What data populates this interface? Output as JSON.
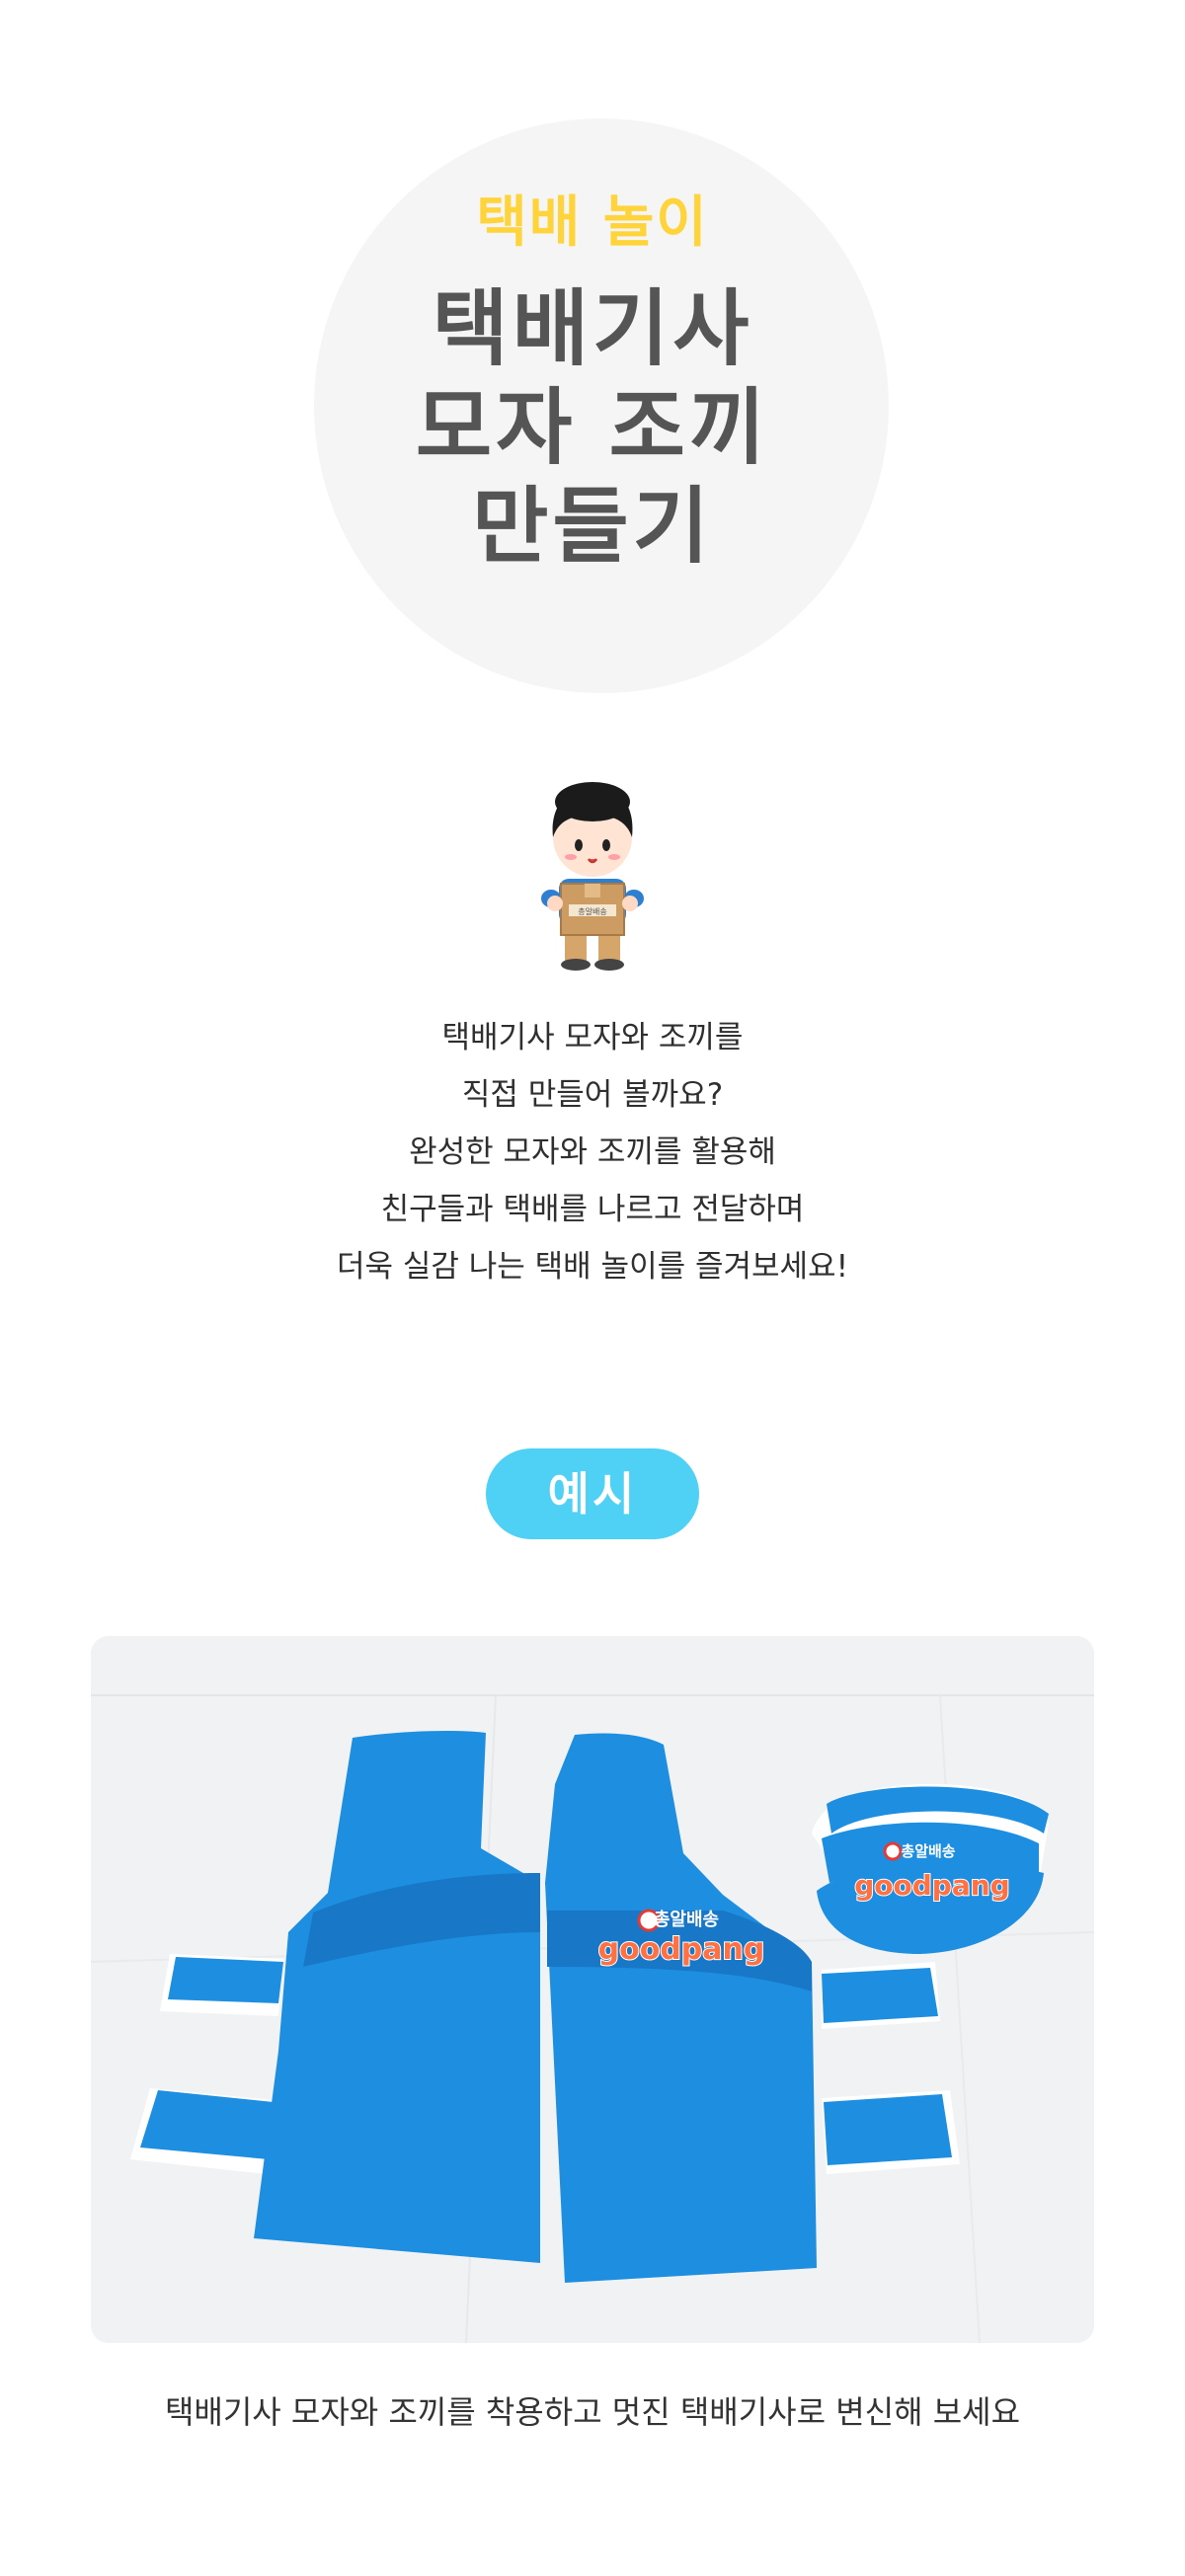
{
  "hero": {
    "eyebrow": "택배 놀이",
    "title_lines": [
      "택배기사",
      "모자 조끼",
      "만들기"
    ]
  },
  "intro": {
    "lines": [
      "택배기사 모자와 조끼를",
      "직접 만들어 볼까요?",
      "완성한 모자와 조끼를 활용해",
      "친구들과 택배를 나르고 전달하며",
      "더욱 실감 나는 택배 놀이를 즐겨보세요!"
    ]
  },
  "example": {
    "label": "예시"
  },
  "photo": {
    "logo_top": "총알배송",
    "logo_bottom": "goodpang"
  },
  "character": {
    "box_label": "총알배송"
  },
  "caption": "택배기사 모자와 조끼를 착용하고 멋진 택배기사로 변신해 보세요",
  "colors": {
    "eyebrow": "#ffd43b",
    "title": "#555555",
    "pill": "#4fd0f5",
    "vest": "#1e8fe0",
    "hero_bg": "#f5f5f5"
  }
}
